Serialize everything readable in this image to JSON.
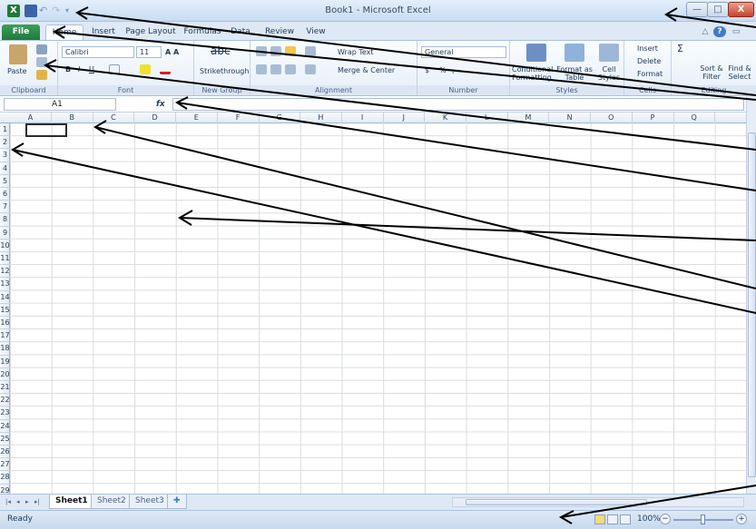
{
  "window": {
    "title": "Book1 - Microsoft Excel",
    "logo": "X",
    "minimize_label": "—",
    "maximize_label": "□",
    "close_label": "X"
  },
  "tabs": {
    "file": "File",
    "home": "Home",
    "insert": "Insert",
    "page_layout": "Page Layout",
    "formulas": "Formulas",
    "data": "Data",
    "review": "Review",
    "view": "View"
  },
  "ribbon": {
    "clipboard": {
      "label": "Clipboard",
      "paste": "Paste"
    },
    "font": {
      "label": "Font",
      "name": "Calibri",
      "size": "11",
      "bold": "B",
      "italic": "I",
      "underline": "U"
    },
    "new_group": {
      "label": "New Group",
      "strikethrough": "Strikethrough",
      "sample": "abc"
    },
    "alignment": {
      "label": "Alignment",
      "wrap_text": "Wrap Text",
      "merge_center": "Merge & Center"
    },
    "number": {
      "label": "Number",
      "format": "General",
      "currency": "$",
      "percent": "%",
      "comma": ","
    },
    "styles": {
      "label": "Styles",
      "conditional": "Conditional Formatting",
      "format_table": "Format as Table",
      "cell_styles": "Cell Styles"
    },
    "cells": {
      "label": "Cells",
      "insert": "Insert",
      "delete": "Delete",
      "format": "Format"
    },
    "editing": {
      "label": "Editing",
      "sort": "Sort & Filter",
      "find": "Find & Select",
      "sigma": "Σ"
    }
  },
  "formula_bar": {
    "name_box": "A1",
    "fx": "fx",
    "value": ""
  },
  "grid": {
    "columns": [
      "A",
      "B",
      "C",
      "D",
      "E",
      "F",
      "G",
      "H",
      "I",
      "J",
      "K",
      "L",
      "M",
      "N",
      "O",
      "P",
      "Q"
    ],
    "rows": [
      "1",
      "2",
      "3",
      "4",
      "5",
      "6",
      "7",
      "8",
      "9",
      "10",
      "11",
      "12",
      "13",
      "14",
      "15",
      "16",
      "17",
      "18",
      "19",
      "20",
      "21",
      "22",
      "23",
      "24",
      "25",
      "26",
      "27",
      "28",
      "29"
    ]
  },
  "sheets": {
    "sheet1": "Sheet1",
    "sheet2": "Sheet2",
    "sheet3": "Sheet3"
  },
  "status": {
    "text": "Ready",
    "zoom": "100%"
  }
}
